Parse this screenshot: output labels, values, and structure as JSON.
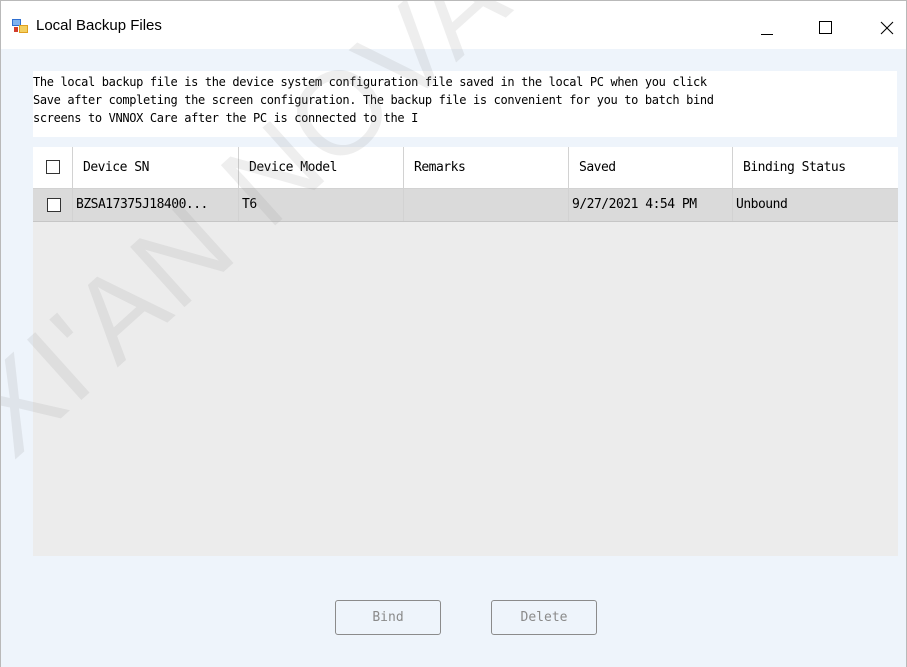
{
  "window": {
    "title": "Local Backup Files",
    "icon": "app-window-icon",
    "controls": [
      "minimize-icon",
      "maximize-icon",
      "close-icon"
    ]
  },
  "description": "The local backup file is the device system configuration file saved in the local PC when you click\nSave after completing the screen configuration. The backup file is convenient for you to batch bind\nscreens to VNNOX Care after the PC is connected to the I",
  "table": {
    "columns": [
      "Device SN",
      "Device Model",
      "Remarks",
      "Saved",
      "Binding Status"
    ],
    "rows": [
      {
        "checked": false,
        "device_sn": "BZSA17375J18400...",
        "device_model": "T6",
        "remarks": "",
        "saved": "9/27/2021 4:54 PM",
        "binding_status": "Unbound"
      }
    ]
  },
  "buttons": {
    "bind": "Bind",
    "delete": "Delete"
  },
  "watermark": "XI'AN NOVASTAR TECH CO",
  "colors": {
    "client_bg": "#eef4fb",
    "selected_row_bg": "#dadada",
    "disabled_text": "#8a8a8a"
  }
}
